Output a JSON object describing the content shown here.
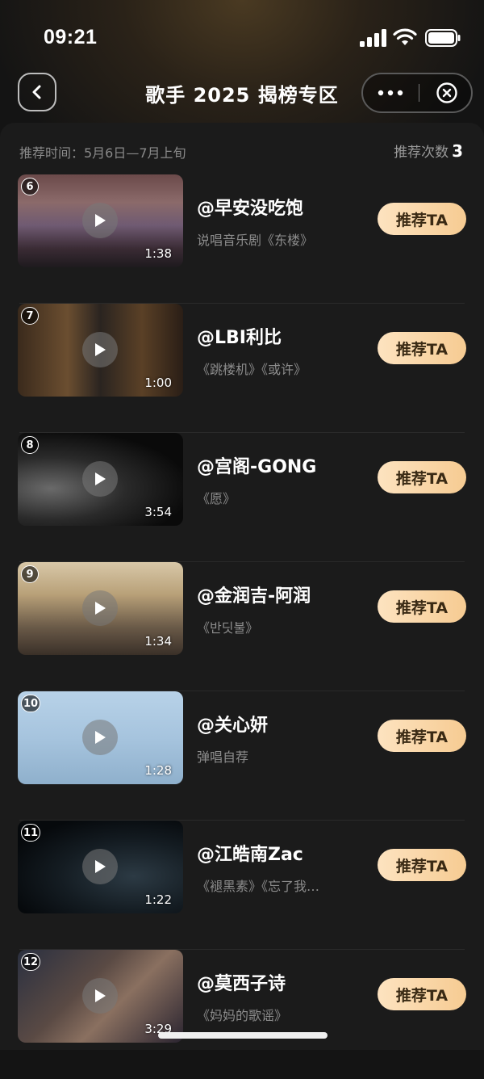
{
  "status": {
    "time": "09:21"
  },
  "header": {
    "title": "歌手 2025 揭榜专区"
  },
  "info": {
    "rec_time": "推荐时间：5月6日—7月上旬",
    "rec_count_label": "推荐次数",
    "rec_count": "3"
  },
  "items": [
    {
      "rank": "6",
      "artist": "@早安没吃饱",
      "songs": "说唱音乐剧《东楼》",
      "duration": "1:38",
      "button": "推荐TA"
    },
    {
      "rank": "7",
      "artist": "@LBI利比",
      "songs": "《跳楼机》《或许》",
      "duration": "1:00",
      "button": "推荐TA"
    },
    {
      "rank": "8",
      "artist": "@宫阁-GONG",
      "songs": "《愿》",
      "duration": "3:54",
      "button": "推荐TA"
    },
    {
      "rank": "9",
      "artist": "@金润吉-阿润",
      "songs": "《반딧불》",
      "duration": "1:34",
      "button": "推荐TA"
    },
    {
      "rank": "10",
      "artist": "@关心妍",
      "songs": "弹唱自荐",
      "duration": "1:28",
      "button": "推荐TA"
    },
    {
      "rank": "11",
      "artist": "@江皓南Zac",
      "songs": "《褪黑素》《忘了我…",
      "duration": "1:22",
      "button": "推荐TA"
    },
    {
      "rank": "12",
      "artist": "@莫西子诗",
      "songs": "《妈妈的歌谣》",
      "duration": "3:29",
      "button": "推荐TA"
    }
  ]
}
